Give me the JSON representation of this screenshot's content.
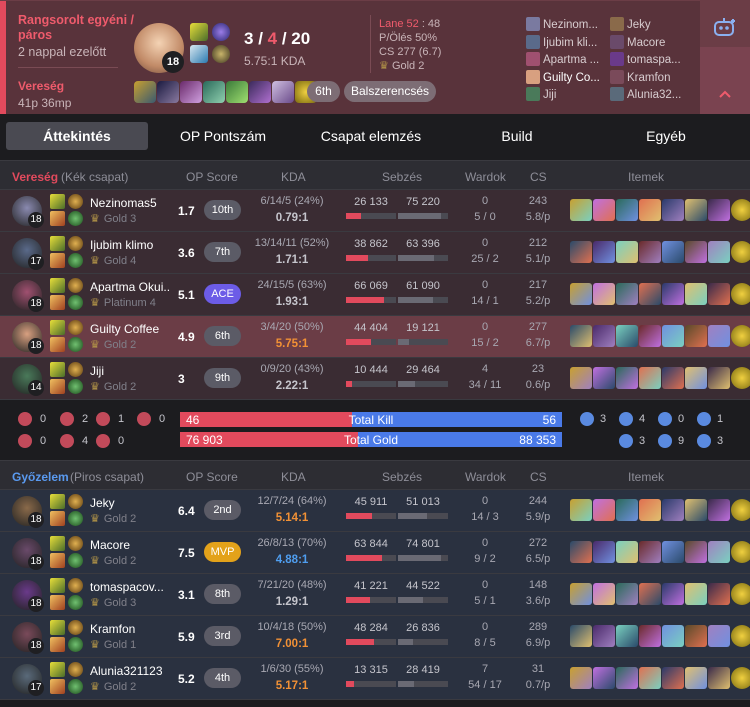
{
  "header": {
    "queue": "Rangsorolt egyéni / páros",
    "ago": "2 nappal ezelőtt",
    "result": "Vereség",
    "duration": "41p 36mp",
    "champ_level": "18",
    "kda_k": "3",
    "kda_d": "4",
    "kda_a": "20",
    "kda_sep1": " / ",
    "kda_sep2": " / ",
    "kda_ratio": "5.75:1 KDA",
    "rank_label": "6th",
    "tag_label": "Balszerencsés",
    "lane_label": "Lane 52",
    "lane_sep": " : 48",
    "kill_participation": "P/Ölés 50%",
    "cs": "CS 277 (6.7)",
    "rank": "Gold 2",
    "players_left": [
      "Nezinom...",
      "Ijubim kli...",
      "Apartma ...",
      "Guilty Co...",
      "Jiji"
    ],
    "players_right": [
      "Jeky",
      "Macore",
      "tomaspa...",
      "Kramfon",
      "Alunia32..."
    ]
  },
  "tabs": [
    "Áttekintés",
    "OP Pontszám",
    "Csapat elemzés",
    "Build",
    "Egyéb"
  ],
  "columns": {
    "ops": "OP Score",
    "kda": "KDA",
    "dmg": "Sebzés",
    "wards": "Wardok",
    "cs": "CS",
    "items": "Itemek"
  },
  "team_lose": {
    "result": "Vereség",
    "side": "(Kék csapat)"
  },
  "team_win": {
    "result": "Győzelem",
    "side": "(Piros csapat)"
  },
  "lose_players": [
    {
      "name": "Nezinomas5",
      "tier": "Gold 3",
      "level": "18",
      "ops": "1.7",
      "rank": "10th",
      "kda": "6/14/5 (24%)",
      "ratio": "0.79:1",
      "dmg": "26 133",
      "taken": "75 220",
      "dmg_pct": 0.3,
      "taken_pct": 0.85,
      "w1": "0",
      "w2": "5 / 0",
      "cs1": "243",
      "cs2": "5.8/p"
    },
    {
      "name": "Ijubim klimo",
      "tier": "Gold 4",
      "level": "17",
      "ops": "3.6",
      "rank": "7th",
      "kda": "13/14/11 (52%)",
      "ratio": "1.71:1",
      "dmg": "38 862",
      "taken": "63 396",
      "dmg_pct": 0.44,
      "taken_pct": 0.72,
      "w1": "0",
      "w2": "25 / 2",
      "cs1": "212",
      "cs2": "5.1/p"
    },
    {
      "name": "Apartma Okui...",
      "tier": "Platinum 4",
      "level": "18",
      "ops": "5.1",
      "rank": "ACE",
      "kda": "24/15/5 (63%)",
      "ratio": "1.93:1",
      "dmg": "66 069",
      "taken": "61 090",
      "dmg_pct": 0.75,
      "taken_pct": 0.69,
      "w1": "0",
      "w2": "14 / 1",
      "cs1": "217",
      "cs2": "5.2/p"
    },
    {
      "name": "Guilty Coffee",
      "tier": "Gold 2",
      "level": "18",
      "ops": "4.9",
      "rank": "6th",
      "kda": "3/4/20 (50%)",
      "ratio": "5.75:1",
      "dmg": "44 404",
      "taken": "19 121",
      "dmg_pct": 0.5,
      "taken_pct": 0.22,
      "w1": "0",
      "w2": "15 / 2",
      "cs1": "277",
      "cs2": "6.7/p"
    },
    {
      "name": "Jiji",
      "tier": "Gold 2",
      "level": "14",
      "ops": "3",
      "rank": "9th",
      "kda": "0/9/20 (43%)",
      "ratio": "2.22:1",
      "dmg": "10 444",
      "taken": "29 464",
      "dmg_pct": 0.12,
      "taken_pct": 0.33,
      "w1": "4",
      "w2": "34 / 11",
      "cs1": "23",
      "cs2": "0.6/p"
    }
  ],
  "win_players": [
    {
      "name": "Jeky",
      "tier": "Gold 2",
      "level": "18",
      "ops": "6.4",
      "rank": "2nd",
      "kda": "12/7/24 (64%)",
      "ratio": "5.14:1",
      "dmg": "45 911",
      "taken": "51 013",
      "dmg_pct": 0.52,
      "taken_pct": 0.58,
      "w1": "0",
      "w2": "14 / 3",
      "cs1": "244",
      "cs2": "5.9/p"
    },
    {
      "name": "Macore",
      "tier": "Gold 2",
      "level": "18",
      "ops": "7.5",
      "rank": "MVP",
      "kda": "26/8/13 (70%)",
      "ratio": "4.88:1",
      "dmg": "63 844",
      "taken": "74 801",
      "dmg_pct": 0.72,
      "taken_pct": 0.85,
      "w1": "0",
      "w2": "9 / 2",
      "cs1": "272",
      "cs2": "6.5/p"
    },
    {
      "name": "tomaspacov...",
      "tier": "Gold 3",
      "level": "18",
      "ops": "3.1",
      "rank": "8th",
      "kda": "7/21/20 (48%)",
      "ratio": "1.29:1",
      "dmg": "41 221",
      "taken": "44 522",
      "dmg_pct": 0.47,
      "taken_pct": 0.5,
      "w1": "0",
      "w2": "5 / 1",
      "cs1": "148",
      "cs2": "3.6/p"
    },
    {
      "name": "Kramfon",
      "tier": "Gold 1",
      "level": "18",
      "ops": "5.9",
      "rank": "3rd",
      "kda": "10/4/18 (50%)",
      "ratio": "7.00:1",
      "dmg": "48 284",
      "taken": "26 836",
      "dmg_pct": 0.55,
      "taken_pct": 0.3,
      "w1": "0",
      "w2": "8 / 5",
      "cs1": "289",
      "cs2": "6.9/p"
    },
    {
      "name": "Alunia321123",
      "tier": "Gold 2",
      "level": "17",
      "ops": "5.2",
      "rank": "4th",
      "kda": "1/6/30 (55%)",
      "ratio": "5.17:1",
      "dmg": "13 315",
      "taken": "28 419",
      "dmg_pct": 0.15,
      "taken_pct": 0.32,
      "w1": "7",
      "w2": "54 / 17",
      "cs1": "31",
      "cs2": "0.7/p"
    }
  ],
  "objectives": {
    "blue_top": [
      "0",
      "2",
      "1",
      "0"
    ],
    "blue_bot": [
      "0",
      "4",
      "0"
    ],
    "red_top": [
      "3",
      "4",
      "0",
      "1"
    ],
    "red_bot": [
      "3",
      "9",
      "3"
    ],
    "total_kill_label": "Total Kill",
    "total_kill_blue": "46",
    "total_kill_red": "56",
    "kill_red_fraction": 0.451,
    "total_gold_label": "Total Gold",
    "total_gold_blue": "76 903",
    "total_gold_red": "88 353",
    "gold_red_fraction": 0.465
  },
  "colors": {
    "loss": "#e24a5d",
    "win": "#4a7ae8",
    "accent_orange": "#f29135",
    "accent_blue": "#4f9ef0"
  }
}
